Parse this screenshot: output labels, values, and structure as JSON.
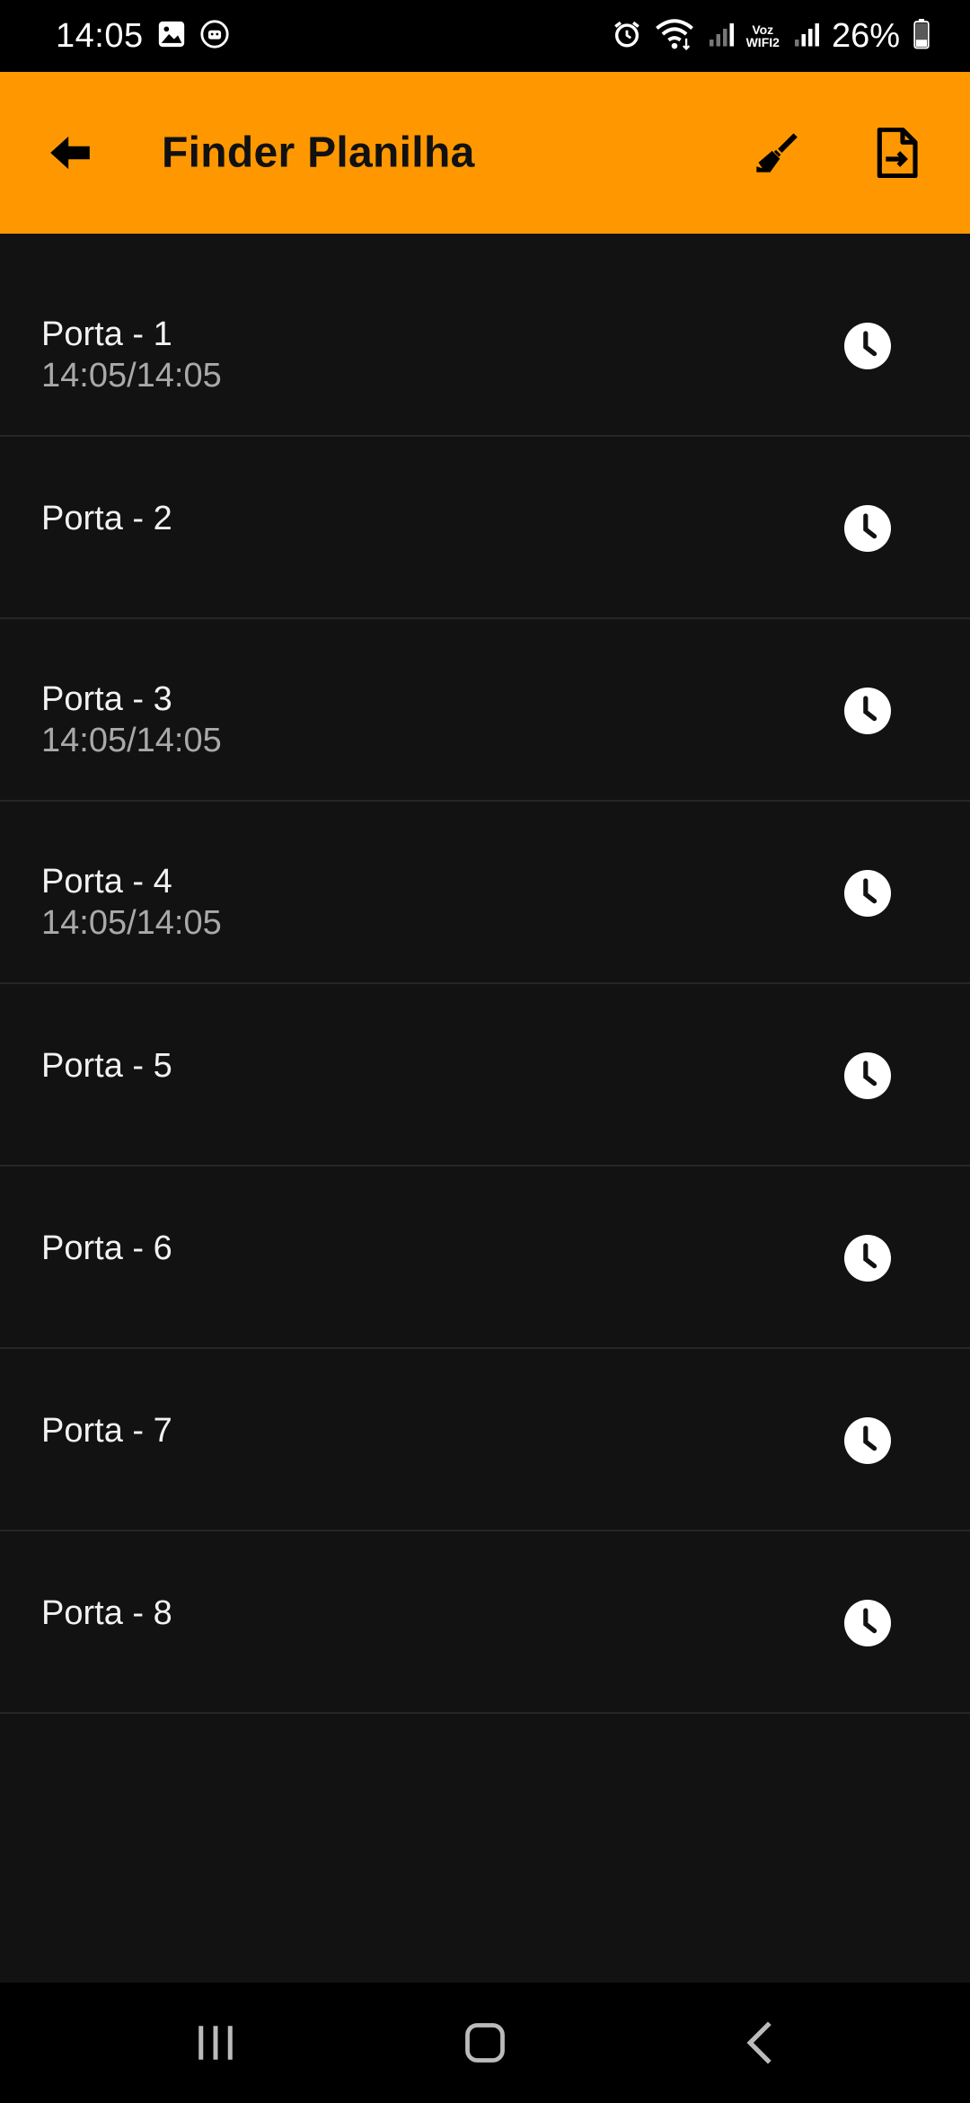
{
  "status_bar": {
    "time": "14:05",
    "voz_line1": "Voz",
    "voz_line2": "WIFI2",
    "battery": "26%"
  },
  "app_bar": {
    "title": "Finder Planilha",
    "background": "#ff9800",
    "back_icon": "arrow-left-icon",
    "actions": [
      "broom-icon",
      "file-export-icon"
    ]
  },
  "list": {
    "items": [
      {
        "label": "Porta - 1",
        "time": "14:05/14:05"
      },
      {
        "label": "Porta - 2",
        "time": ""
      },
      {
        "label": "Porta - 3",
        "time": "14:05/14:05"
      },
      {
        "label": "Porta - 4",
        "time": "14:05/14:05"
      },
      {
        "label": "Porta - 5",
        "time": ""
      },
      {
        "label": "Porta - 6",
        "time": ""
      },
      {
        "label": "Porta - 7",
        "time": ""
      },
      {
        "label": "Porta - 8",
        "time": ""
      }
    ],
    "item_icon": "clock-icon"
  },
  "nav_bar": {
    "buttons": [
      "recents-icon",
      "home-icon",
      "back-icon"
    ]
  }
}
